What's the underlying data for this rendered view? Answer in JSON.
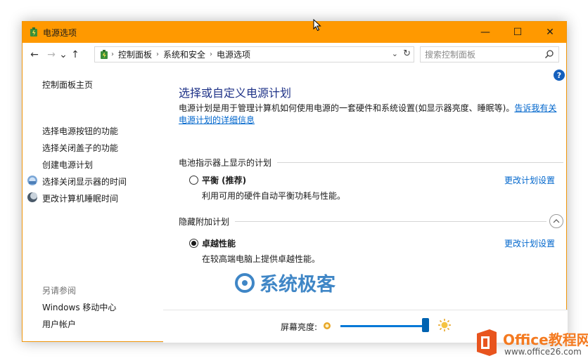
{
  "window": {
    "title": "电源选项",
    "controls": {
      "minimize": "—",
      "maximize": "☐",
      "close": "✕"
    }
  },
  "addressbar": {
    "back": "←",
    "forward": "→",
    "recent": "⌄",
    "up": "↑",
    "breadcrumb": [
      "控制面板",
      "系统和安全",
      "电源选项"
    ],
    "dropdown": "⌄",
    "refresh": "↻",
    "search_placeholder": "搜索控制面板"
  },
  "help": "?",
  "sidebar": {
    "home": "控制面板主页",
    "links": [
      "选择电源按钮的功能",
      "选择关闭盖子的功能",
      "创建电源计划",
      "选择关闭显示器的时间",
      "更改计算机睡眠时间"
    ],
    "see_also_title": "另请参阅",
    "see_also": [
      "Windows 移动中心",
      "用户帐户"
    ]
  },
  "main": {
    "title": "选择或自定义电源计划",
    "description": "电源计划是用于管理计算机如何使用电源的一套硬件和系统设置(如显示器亮度、睡眠等)。",
    "description_link_1": "告诉我有关",
    "description_link_2": "电源计划的详细信息",
    "battery_section": "电池指示器上显示的计划",
    "hidden_section": "隐藏附加计划",
    "plans": [
      {
        "name": "平衡 (推荐)",
        "desc": "利用可用的硬件自动平衡功耗与性能。",
        "link": "更改计划设置",
        "selected": false
      },
      {
        "name": "卓越性能",
        "desc": "在较高端电脑上提供卓越性能。",
        "link": "更改计划设置",
        "selected": true
      }
    ]
  },
  "brightness": {
    "label": "屏幕亮度:",
    "level_percent": 97
  },
  "watermarks": {
    "center": "系统极客",
    "corner_name": "Office教程网",
    "corner_url": "www.office26.com"
  },
  "colors": {
    "titlebar": "#ff9900",
    "accent": "#0078d7",
    "title_text": "#1e3287",
    "link": "#0066cc"
  }
}
